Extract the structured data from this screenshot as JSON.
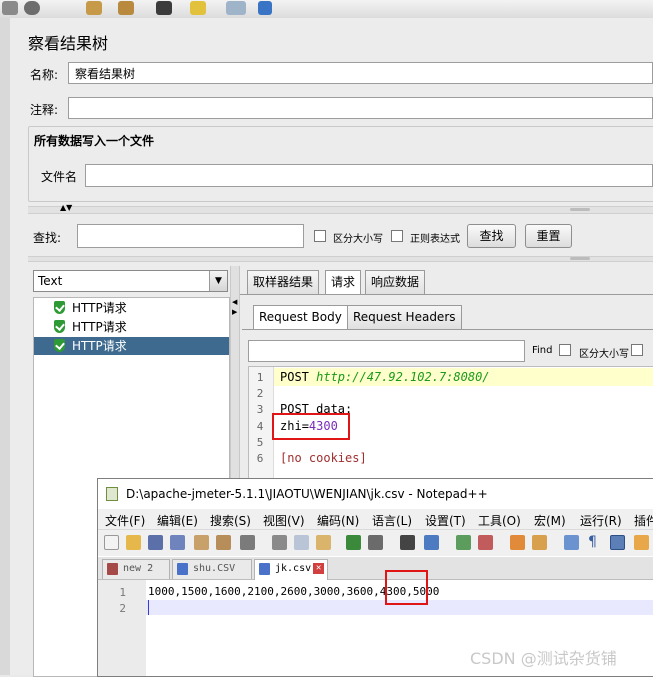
{
  "toolbar": {
    "icons": [
      "settings-icon",
      "stop-icon",
      "broom-icon",
      "broom-all-icon",
      "binoculars-icon",
      "clear-icon",
      "function-icon",
      "help-icon"
    ]
  },
  "panel": {
    "title": "察看结果树",
    "name_label": "名称:",
    "name_value": "察看结果树",
    "comment_label": "注释:",
    "comment_value": ""
  },
  "file_group": {
    "title": "所有数据写入一个文件",
    "filename_label": "文件名",
    "filename_value": ""
  },
  "search": {
    "label": "查找:",
    "value": "",
    "case_label": "区分大小写",
    "regex_label": "正则表达式",
    "find_button": "查找",
    "reset_button": "重置"
  },
  "renderer": {
    "selected": "Text"
  },
  "tree": {
    "items": [
      {
        "label": "HTTP请求",
        "selected": false
      },
      {
        "label": "HTTP请求",
        "selected": false
      },
      {
        "label": "HTTP请求",
        "selected": true
      }
    ]
  },
  "result_tabs": [
    "取样器结果",
    "请求",
    "响应数据"
  ],
  "request_subtabs": [
    "Request Body",
    "Request Headers"
  ],
  "request_find": {
    "find_label": "Find",
    "case_label": "区分大小写"
  },
  "request_body": {
    "lines": [
      {
        "n": "1",
        "text": "POST http://47.92.102.7:8080/"
      },
      {
        "n": "2",
        "text": ""
      },
      {
        "n": "3",
        "text": "POST data:"
      },
      {
        "n": "4",
        "key": "zhi",
        "value": "4300"
      },
      {
        "n": "5",
        "text": ""
      },
      {
        "n": "6",
        "text": "[no cookies]"
      }
    ]
  },
  "notepad": {
    "title": "D:\\apache-jmeter-5.1.1\\JIAOTU\\WENJIAN\\jk.csv - Notepad++",
    "menu": [
      "文件(F)",
      "编辑(E)",
      "搜索(S)",
      "视图(V)",
      "编码(N)",
      "语言(L)",
      "设置(T)",
      "工具(O)",
      "宏(M)",
      "运行(R)",
      "插件"
    ],
    "tabs": [
      {
        "label": "new 2",
        "active": false
      },
      {
        "label": "shu.CSV",
        "active": false
      },
      {
        "label": "jk.csv",
        "active": true
      }
    ],
    "lines": [
      {
        "n": "1",
        "text": "1000,1500,1600,2100,2600,3000,3600,4300,5000"
      },
      {
        "n": "2",
        "text": ""
      }
    ]
  },
  "watermark": "CSDN @测试杂货铺",
  "colors": {
    "selection": "#3d6a8e",
    "highlight_line": "#ffffcc",
    "red_box": "#e01616",
    "url_green": "#1a9a1a",
    "value_purple": "#7a2ab8"
  }
}
